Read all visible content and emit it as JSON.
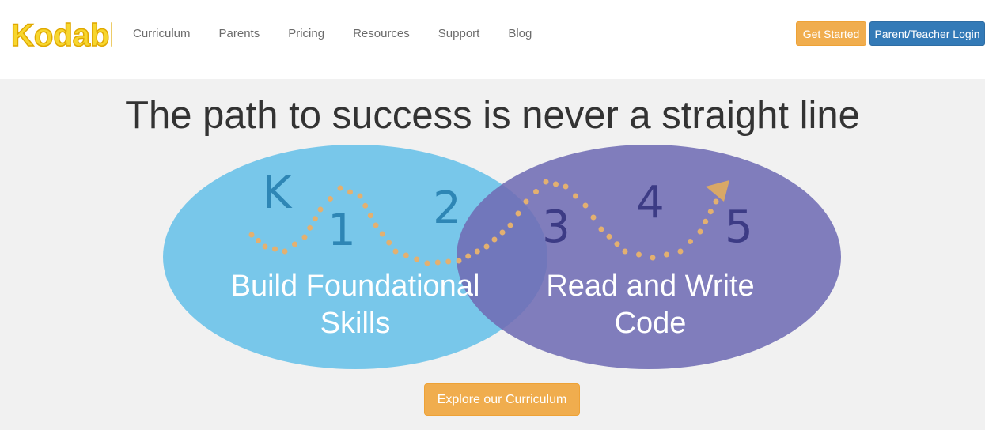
{
  "brand": {
    "logo_text": "Kodable",
    "logo_color": "#f7d62e"
  },
  "nav": {
    "links": [
      "Curriculum",
      "Parents",
      "Pricing",
      "Resources",
      "Support",
      "Blog"
    ],
    "get_started": "Get Started",
    "login": "Parent/Teacher Login"
  },
  "hero": {
    "title": "The path to success is never a straight line",
    "left_label": [
      "Build Foundational",
      "Skills"
    ],
    "right_label": [
      "Read and Write",
      "Code"
    ],
    "grades": [
      "K",
      "1",
      "2",
      "3",
      "4",
      "5"
    ],
    "cta": "Explore our Curriculum"
  },
  "colors": {
    "left_circle": "#6ec3e9",
    "right_circle": "#6f6cb4",
    "path_dots": "#e3b070",
    "cta": "#f0ad4e",
    "login": "#337ab7"
  }
}
